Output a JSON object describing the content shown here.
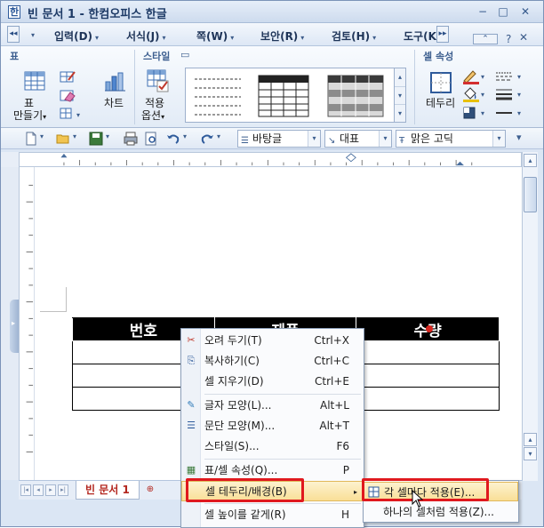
{
  "window": {
    "title": "빈 문서 1 - 한컴오피스 한글",
    "app_icon": "한",
    "controls": {
      "minimize": "−",
      "restore": "□",
      "close": "✕"
    }
  },
  "menubar": {
    "scroll_left": "◂◂",
    "scroll_right": "▸▸",
    "items": [
      "입력(D)",
      "서식(J)",
      "쪽(W)",
      "보안(R)",
      "검토(H)",
      "도구(K"
    ],
    "help": "?",
    "dots": "⋯"
  },
  "ribbon": {
    "groups": {
      "table": {
        "title": "표"
      },
      "style": {
        "title": "스타일"
      },
      "cell": {
        "title": "셀 속성"
      }
    },
    "table_create_label_1": "표",
    "table_create_label_2": "만들기",
    "chart_label": "차트",
    "apply_label_1": "적용",
    "apply_label_2": "옵션",
    "border_label": "테두리"
  },
  "toolbar": {
    "style_combo": "바탕글",
    "font_lang_combo": "대표",
    "font_combo": "맑은 고딕"
  },
  "document": {
    "table_headers": [
      "번호",
      "제품",
      "수량"
    ],
    "empty_rows": 3
  },
  "tabs": {
    "active": "빈 문서 1"
  },
  "context_menu": {
    "items": [
      {
        "icon": "scissors-icon",
        "glyph": "✂",
        "label": "오려 두기(T)",
        "shortcut": "Ctrl+X"
      },
      {
        "icon": "copy-icon",
        "glyph": "⎘",
        "label": "복사하기(C)",
        "shortcut": "Ctrl+C"
      },
      {
        "icon": "",
        "glyph": "",
        "label": "셀 지우기(D)",
        "shortcut": "Ctrl+E"
      },
      {
        "icon": "char-shape-icon",
        "glyph": "✎",
        "label": "글자 모양(L)...",
        "shortcut": "Alt+L"
      },
      {
        "icon": "para-shape-icon",
        "glyph": "☰",
        "label": "문단 모양(M)...",
        "shortcut": "Alt+T"
      },
      {
        "icon": "",
        "glyph": "",
        "label": "스타일(S)...",
        "shortcut": "F6"
      },
      {
        "icon": "table-props-icon",
        "glyph": "▦",
        "label": "표/셀 속성(Q)...",
        "shortcut": "P"
      },
      {
        "icon": "",
        "glyph": "",
        "label": "셀 테두리/배경(B)",
        "shortcut": ""
      },
      {
        "icon": "",
        "glyph": "",
        "label": "셀 높이를 같게(R)",
        "shortcut": "H"
      }
    ],
    "submenu_arrow": "▸"
  },
  "submenu": {
    "items": [
      {
        "label": "각 셀마다 적용(E)..."
      },
      {
        "label": "하나의 셀처럼 적용(Z)..."
      }
    ]
  }
}
